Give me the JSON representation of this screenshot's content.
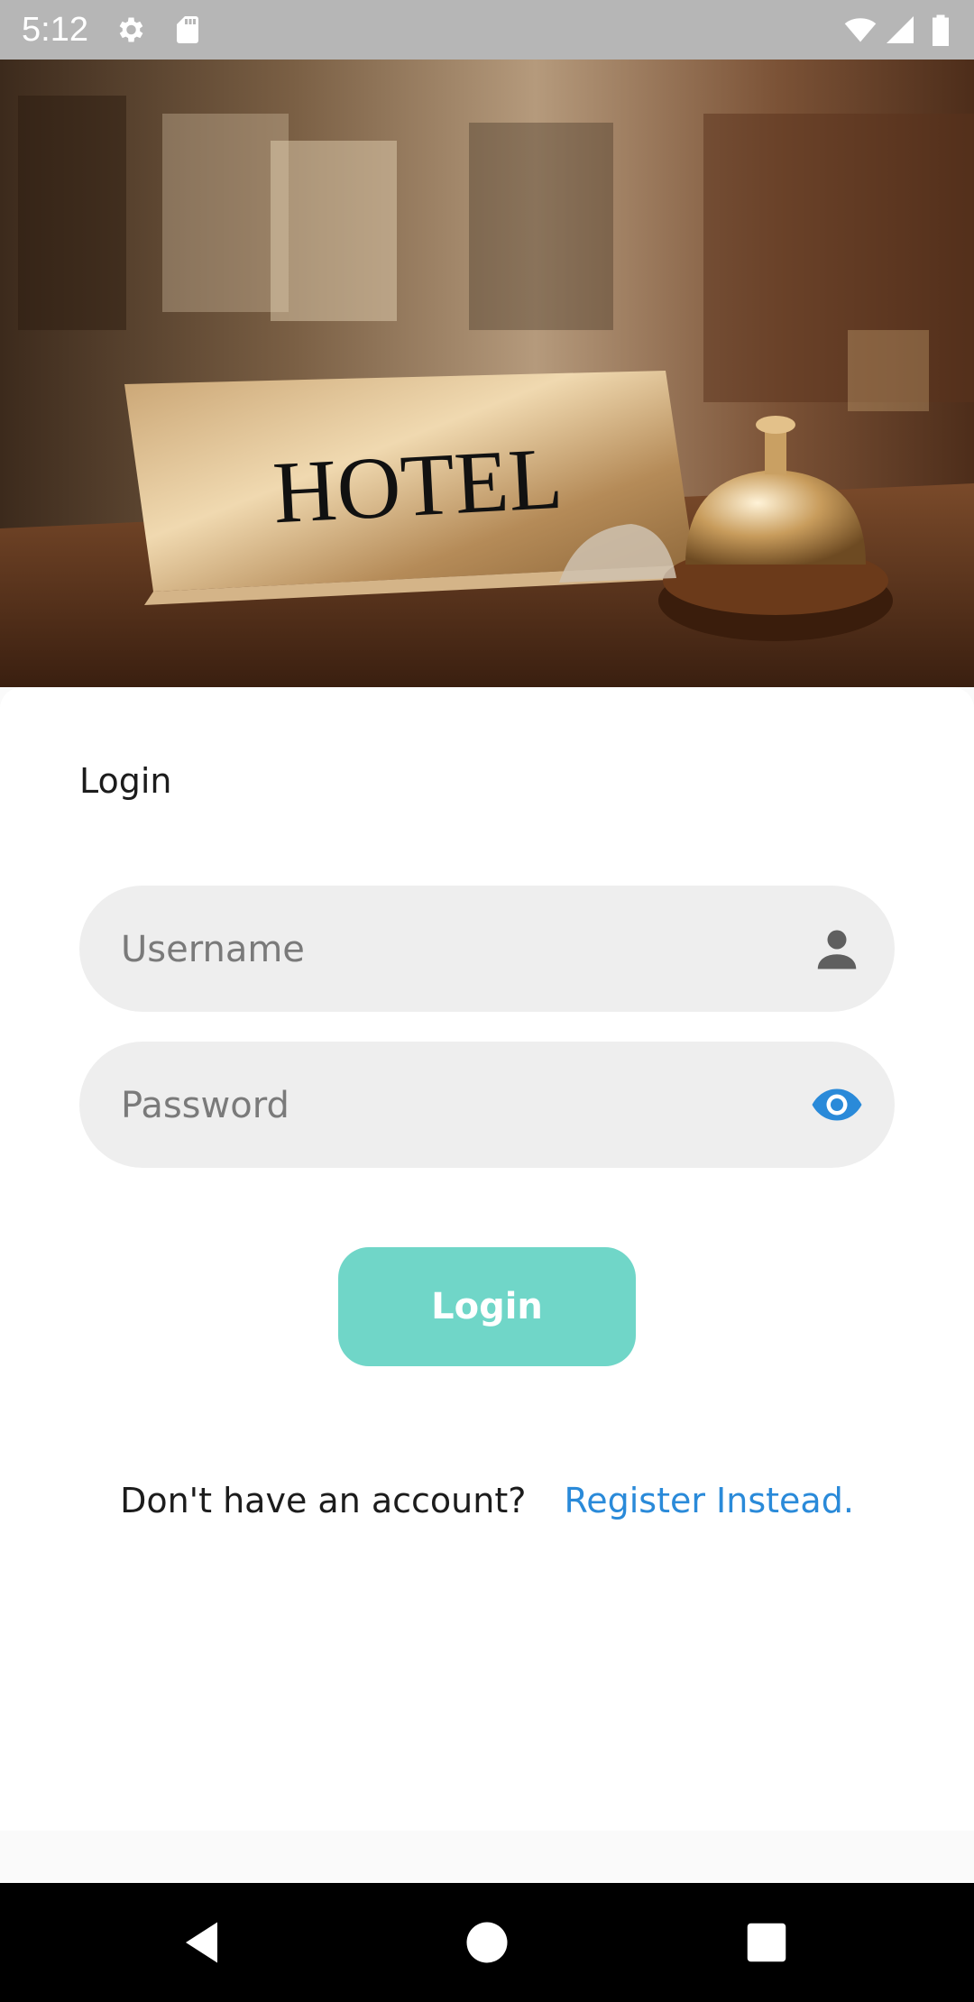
{
  "status_bar": {
    "time": "5:12",
    "icons": [
      "gear-icon",
      "sd-card-icon",
      "wifi-icon",
      "signal-icon",
      "battery-icon"
    ]
  },
  "hero": {
    "sign_text": "HOTEL"
  },
  "login": {
    "title": "Login",
    "username_placeholder": "Username",
    "password_placeholder": "Password",
    "button_label": "Login",
    "register_prompt": "Don't have an account?",
    "register_link": "Register Instead."
  },
  "colors": {
    "accent": "#70d6c8",
    "link": "#2a8ad9",
    "field_bg": "#eeeeee"
  },
  "nav_bar": {
    "icons": [
      "back-icon",
      "home-icon",
      "recents-icon"
    ]
  }
}
